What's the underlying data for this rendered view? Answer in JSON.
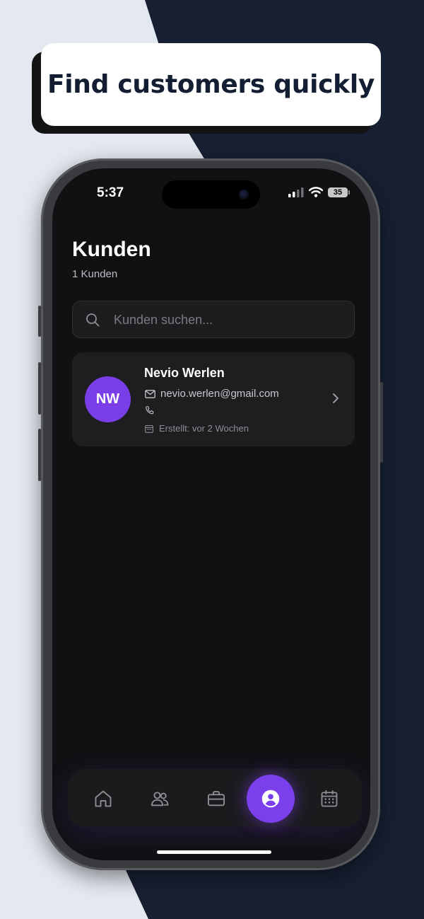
{
  "headline": "Find customers quickly",
  "status_bar": {
    "time": "5:37",
    "battery": "35"
  },
  "page": {
    "title": "Kunden",
    "subtitle": "1 Kunden"
  },
  "search": {
    "placeholder": "Kunden suchen...",
    "value": "",
    "icon": "search-icon"
  },
  "customers": [
    {
      "initials": "NW",
      "name": "Nevio Werlen",
      "email": "nevio.werlen@gmail.com",
      "phone": "",
      "created": "Erstellt: vor 2 Wochen"
    }
  ],
  "tabbar": {
    "items": [
      {
        "icon": "home-icon",
        "active": false
      },
      {
        "icon": "users-icon",
        "active": false
      },
      {
        "icon": "briefcase-icon",
        "active": false
      },
      {
        "icon": "user-circle-icon",
        "active": true
      },
      {
        "icon": "calendar-icon",
        "active": false
      }
    ]
  },
  "colors": {
    "accent": "#7B3FEC",
    "screen_bg": "#111113",
    "card_bg": "#1E1E21",
    "backdrop_light": "#E4E8F0",
    "backdrop_dark": "#172033",
    "headline_text": "#141E33"
  }
}
